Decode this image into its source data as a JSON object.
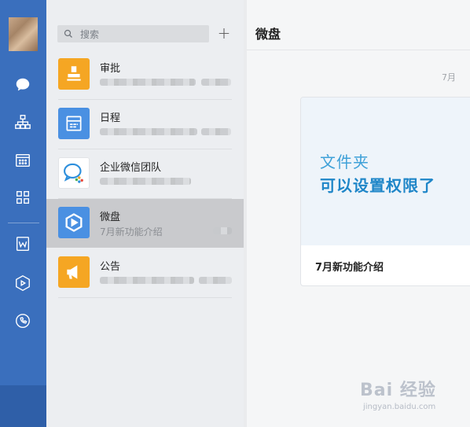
{
  "sidebar": {
    "items": [
      {
        "icon": "chat-icon"
      },
      {
        "icon": "org-chart-icon"
      },
      {
        "icon": "calendar-grid-icon"
      },
      {
        "icon": "apps-grid-icon"
      },
      {
        "icon": "doc-w-icon"
      },
      {
        "icon": "weipan-icon"
      },
      {
        "icon": "phone-icon"
      }
    ]
  },
  "search": {
    "placeholder": "搜索"
  },
  "add_label": "+",
  "list": {
    "items": [
      {
        "title": "审批",
        "subtitle": "",
        "icon": "approval-stamp-icon",
        "color": "#f5a623"
      },
      {
        "title": "日程",
        "subtitle": "",
        "icon": "schedule-icon",
        "color": "#4a90e2"
      },
      {
        "title": "企业微信团队",
        "subtitle": "",
        "icon": "wecom-team-icon",
        "color": "#ffffff"
      },
      {
        "title": "微盘",
        "subtitle": "7月新功能介绍",
        "icon": "weipan-icon",
        "color": "#4a90e2"
      },
      {
        "title": "公告",
        "subtitle": "",
        "icon": "announcement-icon",
        "color": "#f5a623"
      }
    ]
  },
  "content": {
    "title": "微盘",
    "date": "7月",
    "card": {
      "line1": "文件夹",
      "line2": "可以设置权限了",
      "caption": "7月新功能介绍"
    }
  },
  "watermark": {
    "logo": "Bai 经验",
    "sub": "jingyan.baidu.com"
  },
  "colors": {
    "rail": "#3a6fbd",
    "list_bg": "#eceef1",
    "active": "#c9cacd",
    "accent": "#1f86c8"
  }
}
